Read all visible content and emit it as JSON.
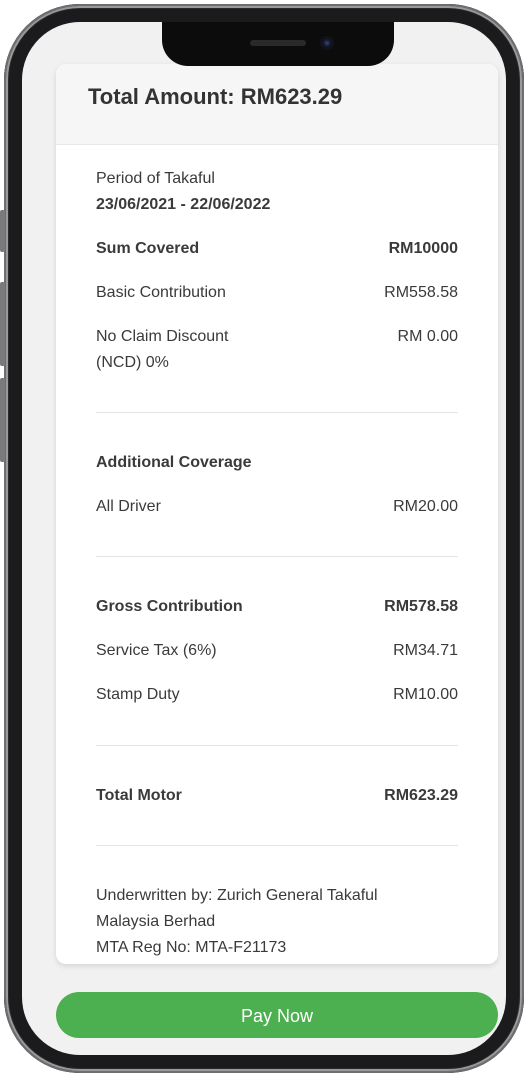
{
  "header": {
    "total_amount": "Total Amount: RM623.29"
  },
  "period": {
    "label": "Period of Takaful",
    "value": "23/06/2021 - 22/06/2022"
  },
  "summary": {
    "sum_covered": {
      "label": "Sum Covered",
      "value": "RM10000"
    },
    "basic_contribution": {
      "label": "Basic Contribution",
      "value": "RM558.58"
    },
    "ncd": {
      "label_line1": "No Claim Discount",
      "label_line2": "(NCD) 0%",
      "value": "RM 0.00"
    }
  },
  "additional": {
    "title": "Additional Coverage",
    "all_driver": {
      "label": "All Driver",
      "value": "RM20.00"
    }
  },
  "gross": {
    "gross_contribution": {
      "label": "Gross Contribution",
      "value": "RM578.58"
    },
    "service_tax": {
      "label": "Service Tax (6%)",
      "value": "RM34.71"
    },
    "stamp_duty": {
      "label": "Stamp Duty",
      "value": "RM10.00"
    }
  },
  "total_motor": {
    "label": "Total Motor",
    "value": "RM623.29"
  },
  "footer": {
    "line1": "Underwritten by: Zurich General Takaful",
    "line2": "Malaysia Berhad",
    "line3": "MTA Reg No: MTA-F21173"
  },
  "pay_button": {
    "label": "Pay Now"
  },
  "colors": {
    "accent": "#4caf50",
    "header_bg": "#f6f6f6",
    "text": "#3a3a3a"
  }
}
